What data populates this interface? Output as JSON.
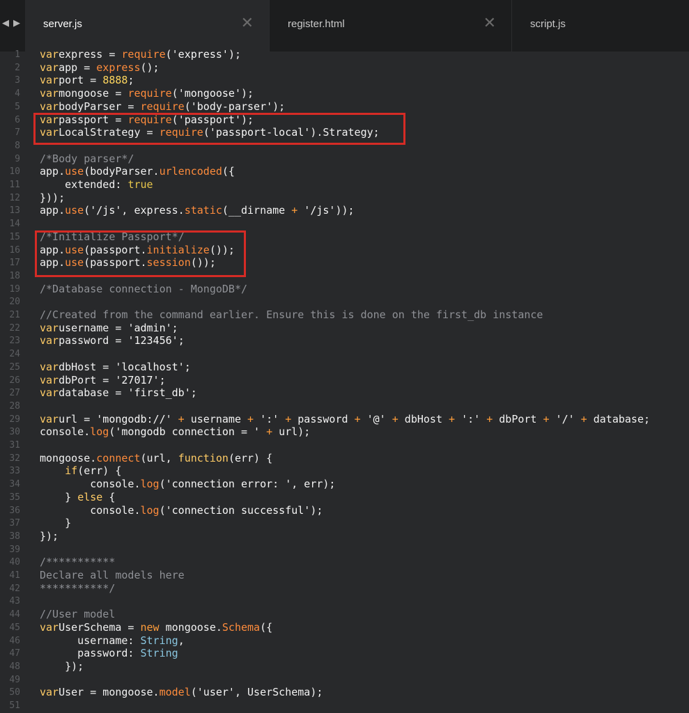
{
  "nav": {
    "back": "◀",
    "forward": "▶"
  },
  "tabs": [
    {
      "label": "server.js",
      "close": "✕",
      "active": true
    },
    {
      "label": "register.html",
      "close": "✕",
      "active": false
    },
    {
      "label": "script.js",
      "active": false
    }
  ],
  "lines": [
    {
      "n": "1",
      "seg": [
        [
          "kw",
          "var"
        ],
        [
          "",
          "express = "
        ],
        [
          "fn",
          "require"
        ],
        [
          "",
          "("
        ],
        [
          "str",
          "'express'"
        ],
        [
          "",
          ");"
        ]
      ]
    },
    {
      "n": "2",
      "seg": [
        [
          "kw",
          "var"
        ],
        [
          "",
          "app = "
        ],
        [
          "fn",
          "express"
        ],
        [
          "",
          "();"
        ]
      ]
    },
    {
      "n": "3",
      "seg": [
        [
          "kw",
          "var"
        ],
        [
          "",
          "port = "
        ],
        [
          "num",
          "8888"
        ],
        [
          "",
          ";"
        ]
      ]
    },
    {
      "n": "4",
      "seg": [
        [
          "kw",
          "var"
        ],
        [
          "",
          "mongoose = "
        ],
        [
          "fn",
          "require"
        ],
        [
          "",
          "("
        ],
        [
          "str",
          "'mongoose'"
        ],
        [
          "",
          ");"
        ]
      ]
    },
    {
      "n": "5",
      "seg": [
        [
          "kw",
          "var"
        ],
        [
          "",
          "bodyParser = "
        ],
        [
          "fn",
          "require"
        ],
        [
          "",
          "("
        ],
        [
          "str",
          "'body-parser'"
        ],
        [
          "",
          ");"
        ]
      ]
    },
    {
      "n": "6",
      "seg": [
        [
          "kw",
          "var"
        ],
        [
          "",
          "passport = "
        ],
        [
          "fn",
          "require"
        ],
        [
          "",
          "("
        ],
        [
          "str",
          "'passport'"
        ],
        [
          "",
          ");"
        ]
      ]
    },
    {
      "n": "7",
      "seg": [
        [
          "kw",
          "var"
        ],
        [
          "",
          "LocalStrategy = "
        ],
        [
          "fn",
          "require"
        ],
        [
          "",
          "("
        ],
        [
          "str",
          "'passport-local'"
        ],
        [
          "",
          ").Strategy;"
        ]
      ]
    },
    {
      "n": "8",
      "seg": []
    },
    {
      "n": "9",
      "seg": [
        [
          "cm",
          "/*Body parser*/"
        ]
      ]
    },
    {
      "n": "10",
      "seg": [
        [
          "",
          "app."
        ],
        [
          "fn",
          "use"
        ],
        [
          "",
          "(bodyParser."
        ],
        [
          "fn",
          "urlencoded"
        ],
        [
          "",
          "({"
        ]
      ]
    },
    {
      "n": "11",
      "seg": [
        [
          "",
          "    extended: "
        ],
        [
          "bool",
          "true"
        ]
      ]
    },
    {
      "n": "12",
      "seg": [
        [
          "",
          "}));"
        ]
      ]
    },
    {
      "n": "13",
      "seg": [
        [
          "",
          "app."
        ],
        [
          "fn",
          "use"
        ],
        [
          "",
          "("
        ],
        [
          "str",
          "'/js'"
        ],
        [
          "",
          ", express."
        ],
        [
          "fn",
          "static"
        ],
        [
          "",
          "(__dirname "
        ],
        [
          "op",
          "+"
        ],
        [
          "str",
          " '/js'"
        ],
        [
          "",
          "));"
        ]
      ]
    },
    {
      "n": "14",
      "seg": []
    },
    {
      "n": "15",
      "seg": [
        [
          "cm",
          "/*Initialize Passport*/"
        ]
      ]
    },
    {
      "n": "16",
      "seg": [
        [
          "",
          "app."
        ],
        [
          "fn",
          "use"
        ],
        [
          "",
          "(passport."
        ],
        [
          "fn",
          "initialize"
        ],
        [
          "",
          "());"
        ]
      ]
    },
    {
      "n": "17",
      "seg": [
        [
          "",
          "app."
        ],
        [
          "fn",
          "use"
        ],
        [
          "",
          "(passport."
        ],
        [
          "fn",
          "session"
        ],
        [
          "",
          "());"
        ]
      ]
    },
    {
      "n": "18",
      "seg": []
    },
    {
      "n": "19",
      "seg": [
        [
          "cm",
          "/*Database connection - MongoDB*/"
        ]
      ]
    },
    {
      "n": "20",
      "seg": []
    },
    {
      "n": "21",
      "seg": [
        [
          "cm",
          "//Created from the command earlier. Ensure this is done on the first_db instance"
        ]
      ]
    },
    {
      "n": "22",
      "seg": [
        [
          "kw",
          "var"
        ],
        [
          "",
          "username = "
        ],
        [
          "str",
          "'admin'"
        ],
        [
          "",
          ";"
        ]
      ]
    },
    {
      "n": "23",
      "seg": [
        [
          "kw",
          "var"
        ],
        [
          "",
          "password = "
        ],
        [
          "str",
          "'123456'"
        ],
        [
          "",
          ";"
        ]
      ]
    },
    {
      "n": "24",
      "seg": []
    },
    {
      "n": "25",
      "seg": [
        [
          "kw",
          "var"
        ],
        [
          "",
          "dbHost = "
        ],
        [
          "str",
          "'localhost'"
        ],
        [
          "",
          ";"
        ]
      ]
    },
    {
      "n": "26",
      "seg": [
        [
          "kw",
          "var"
        ],
        [
          "",
          "dbPort = "
        ],
        [
          "str",
          "'27017'"
        ],
        [
          "",
          ";"
        ]
      ]
    },
    {
      "n": "27",
      "seg": [
        [
          "kw",
          "var"
        ],
        [
          "",
          "database = "
        ],
        [
          "str",
          "'first_db'"
        ],
        [
          "",
          ";"
        ]
      ]
    },
    {
      "n": "28",
      "seg": []
    },
    {
      "n": "29",
      "seg": [
        [
          "kw",
          "var"
        ],
        [
          "",
          "url = "
        ],
        [
          "str",
          "'mongodb://'"
        ],
        [
          "op",
          " +"
        ],
        [
          "",
          " username "
        ],
        [
          "op",
          "+"
        ],
        [
          "str",
          " ':'"
        ],
        [
          "op",
          " +"
        ],
        [
          "",
          " password "
        ],
        [
          "op",
          "+"
        ],
        [
          "str",
          " '@'"
        ],
        [
          "op",
          " +"
        ],
        [
          "",
          " dbHost "
        ],
        [
          "op",
          "+"
        ],
        [
          "str",
          " ':'"
        ],
        [
          "op",
          " +"
        ],
        [
          "",
          " dbPort "
        ],
        [
          "op",
          "+"
        ],
        [
          "str",
          " '/'"
        ],
        [
          "op",
          " +"
        ],
        [
          "",
          " database;"
        ]
      ]
    },
    {
      "n": "30",
      "seg": [
        [
          "",
          "console."
        ],
        [
          "fn",
          "log"
        ],
        [
          "",
          "("
        ],
        [
          "str",
          "'mongodb connection = '"
        ],
        [
          "op",
          " +"
        ],
        [
          "",
          " url);"
        ]
      ]
    },
    {
      "n": "31",
      "seg": []
    },
    {
      "n": "32",
      "seg": [
        [
          "",
          "mongoose."
        ],
        [
          "fn",
          "connect"
        ],
        [
          "",
          "(url, "
        ],
        [
          "kw",
          "function"
        ],
        [
          "",
          "(err) {"
        ]
      ]
    },
    {
      "n": "33",
      "seg": [
        [
          "",
          "    "
        ],
        [
          "kw",
          "if"
        ],
        [
          "",
          "(err) {"
        ]
      ]
    },
    {
      "n": "34",
      "seg": [
        [
          "",
          "        console."
        ],
        [
          "fn",
          "log"
        ],
        [
          "",
          "("
        ],
        [
          "str",
          "'connection error: '"
        ],
        [
          "",
          ", err);"
        ]
      ]
    },
    {
      "n": "35",
      "seg": [
        [
          "",
          "    } "
        ],
        [
          "kw",
          "else"
        ],
        [
          "",
          " {"
        ]
      ]
    },
    {
      "n": "36",
      "seg": [
        [
          "",
          "        console."
        ],
        [
          "fn",
          "log"
        ],
        [
          "",
          "("
        ],
        [
          "str",
          "'connection successful'"
        ],
        [
          "",
          ");"
        ]
      ]
    },
    {
      "n": "37",
      "seg": [
        [
          "",
          "    }"
        ]
      ]
    },
    {
      "n": "38",
      "seg": [
        [
          "",
          "});"
        ]
      ]
    },
    {
      "n": "39",
      "seg": []
    },
    {
      "n": "40",
      "seg": [
        [
          "cm",
          "/***********"
        ]
      ]
    },
    {
      "n": "41",
      "seg": [
        [
          "cm",
          "Declare all models here"
        ]
      ]
    },
    {
      "n": "42",
      "seg": [
        [
          "cm",
          "***********/"
        ]
      ]
    },
    {
      "n": "43",
      "seg": []
    },
    {
      "n": "44",
      "seg": [
        [
          "cm",
          "//User model"
        ]
      ]
    },
    {
      "n": "45",
      "seg": [
        [
          "kw",
          "var"
        ],
        [
          "",
          "UserSchema = "
        ],
        [
          "op",
          "new"
        ],
        [
          "",
          " mongoose."
        ],
        [
          "fn",
          "Schema"
        ],
        [
          "",
          "({"
        ]
      ]
    },
    {
      "n": "46",
      "seg": [
        [
          "",
          "      username: "
        ],
        [
          "ty",
          "String"
        ],
        [
          "",
          ","
        ]
      ]
    },
    {
      "n": "47",
      "seg": [
        [
          "",
          "      password: "
        ],
        [
          "ty",
          "String"
        ]
      ]
    },
    {
      "n": "48",
      "seg": [
        [
          "",
          "    });"
        ]
      ]
    },
    {
      "n": "49",
      "seg": []
    },
    {
      "n": "50",
      "seg": [
        [
          "kw",
          "var"
        ],
        [
          "",
          "User = mongoose."
        ],
        [
          "fn",
          "model"
        ],
        [
          "",
          "("
        ],
        [
          "str",
          "'user'"
        ],
        [
          "",
          ", UserSchema);"
        ]
      ]
    },
    {
      "n": "51",
      "seg": []
    }
  ]
}
